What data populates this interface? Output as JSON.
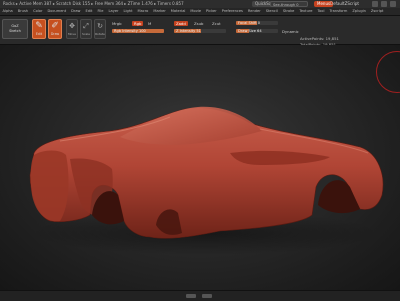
{
  "titlebar": {
    "text": "Rocks   ▸ Active Mem 387  ▸ Scratch Disk 155  ▸ Free Mem 364  ▸ ZTime 1.476  ▸ Timers 0.857",
    "quicksave": "QuickSave",
    "see_through": "See-through 0",
    "menus": "Menus",
    "default_script": "DefaultZScript"
  },
  "menubar": [
    "Alpha",
    "Brush",
    "Color",
    "Document",
    "Draw",
    "Edit",
    "File",
    "Layer",
    "Light",
    "Macro",
    "Marker",
    "Material",
    "Movie",
    "Picker",
    "Preferences",
    "Render",
    "Stencil",
    "Stroke",
    "Texture",
    "Tool",
    "Transform",
    "Zplugin",
    "Zscript"
  ],
  "toolbar": {
    "goz_label": "GoZ",
    "sketch_label": "Sketch",
    "edit_label": "Edit",
    "draw_label": "Draw",
    "move_label": "Move",
    "scale_label": "Scale",
    "rotate_label": "Rotate",
    "mrgb": "Mrgb",
    "rgb": "Rgb",
    "m": "M",
    "zadd": "Zadd",
    "zsub": "Zsub",
    "zcut": "Zcut",
    "rgb_intensity": "Rgb Intensity 100",
    "z_intensity": "Z Intensity 51",
    "focal_shift": "Focal Shift 0",
    "draw_size": "Draw Size 64",
    "dynamic": "Dynamic",
    "active_points": "ActivePoints: 19,851",
    "total_points": "TotalPoints: 19,851"
  },
  "sliders": {
    "rgb_intensity_value": 1.0,
    "z_intensity_value": 0.51,
    "focal_shift_value": 0.5,
    "draw_size_value": 0.3
  },
  "colors": {
    "accent": "#c6421f",
    "model": "#b34a3b",
    "background": "#1c1c1c"
  }
}
